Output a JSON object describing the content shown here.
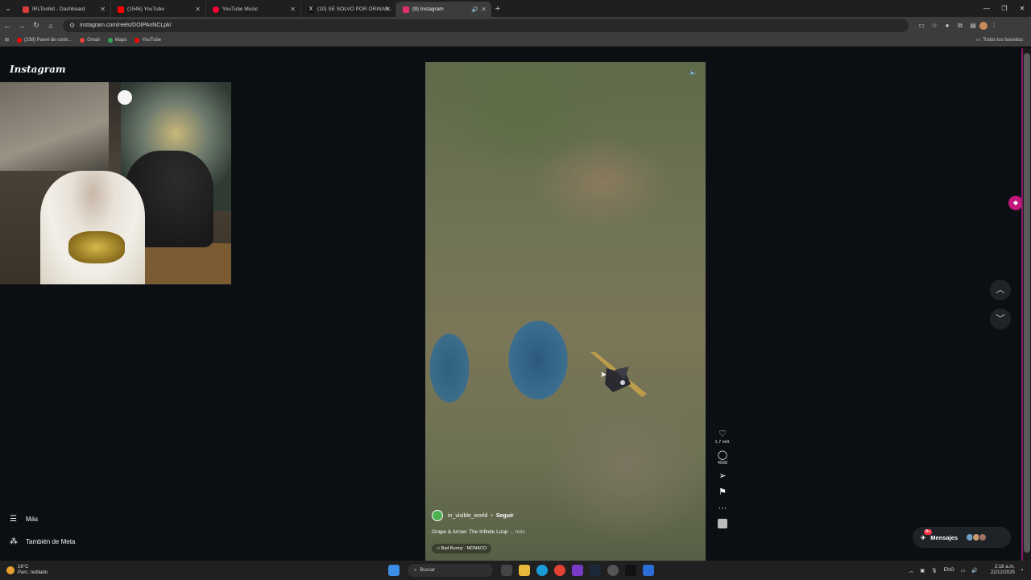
{
  "tabs": [
    {
      "title": "IRLToolkit - Dashboard",
      "color": "#d93a3a"
    },
    {
      "title": "(1546) YouTube",
      "color": "#ff0000"
    },
    {
      "title": "YouTube Music",
      "color": "#ff0033"
    },
    {
      "title": "(10) SE SOLVO POR ORINAR - ",
      "color": "#111111"
    },
    {
      "title": "(9) Instagram",
      "color": "#e1306c"
    }
  ],
  "address": {
    "url": "instagram.com/reels/DOIPAnNCLpk/"
  },
  "bookmarks": [
    {
      "label": "(238) Panel de contr...",
      "color": "#ff0000"
    },
    {
      "label": "Gmail",
      "color": "#ea4335"
    },
    {
      "label": "Maps",
      "color": "#34a853"
    },
    {
      "label": "YouTube",
      "color": "#ff0000"
    }
  ],
  "bookmarks_right": "Todos los favoritos",
  "instagram": {
    "logo": "Instagram",
    "sidebar": {
      "more": "Más",
      "meta": "También de Meta"
    },
    "reel": {
      "author": "in_visible_world",
      "follow": "Seguir",
      "caption": "Grape & Arrow: The Infinite Loop",
      "caption_more": "... más",
      "song": "Bad Bunny · MONACO"
    },
    "actions": {
      "likes": "1,7 mill.",
      "comments": "4068"
    },
    "messages": {
      "label": "Mensajes",
      "badge": "9+"
    }
  },
  "taskbar": {
    "temp": "16°C",
    "weather": "Parc. nublado",
    "search": "Buscar",
    "lang": "ENG",
    "time": "2:18 a.m.",
    "date": "22/12/2025"
  }
}
